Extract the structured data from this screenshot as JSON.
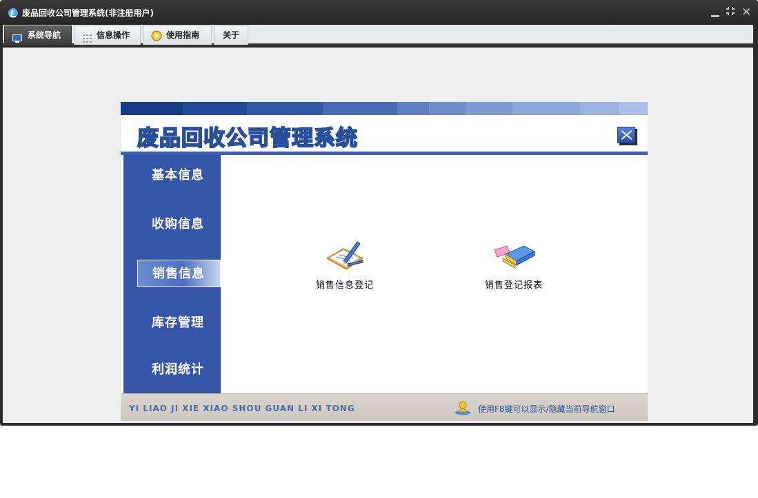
{
  "window": {
    "title": "废品回收公司管理系统(非注册用户)"
  },
  "tabs": [
    {
      "label": "系统导航",
      "icon": "monitor-icon",
      "active": true
    },
    {
      "label": "信息操作",
      "icon": "grid-icon",
      "active": false
    },
    {
      "label": "使用指南",
      "icon": "help-icon",
      "active": false
    },
    {
      "label": "关于",
      "icon": "",
      "active": false
    }
  ],
  "panel": {
    "title": "废品回收公司管理系统",
    "sidebar": [
      {
        "label": "基本信息"
      },
      {
        "label": "收购信息"
      },
      {
        "label": "销售信息",
        "active": true
      },
      {
        "label": "库存管理"
      },
      {
        "label": "利润统计"
      }
    ],
    "actions": [
      {
        "label": "销售信息登记",
        "icon": "notepad-pencil-icon"
      },
      {
        "label": "销售登记报表",
        "icon": "report-books-icon"
      }
    ],
    "footer": {
      "left_text": "YI LIAO JI XIE XIAO SHOU GUAN LI XI TONG",
      "right_text": "使用F8键可以显示/隐藏当前导航窗口"
    }
  },
  "colors": {
    "sidebar_bg": "#3556a8",
    "accent": "#2a4f9a",
    "titlebar": "#2b2b2b"
  }
}
